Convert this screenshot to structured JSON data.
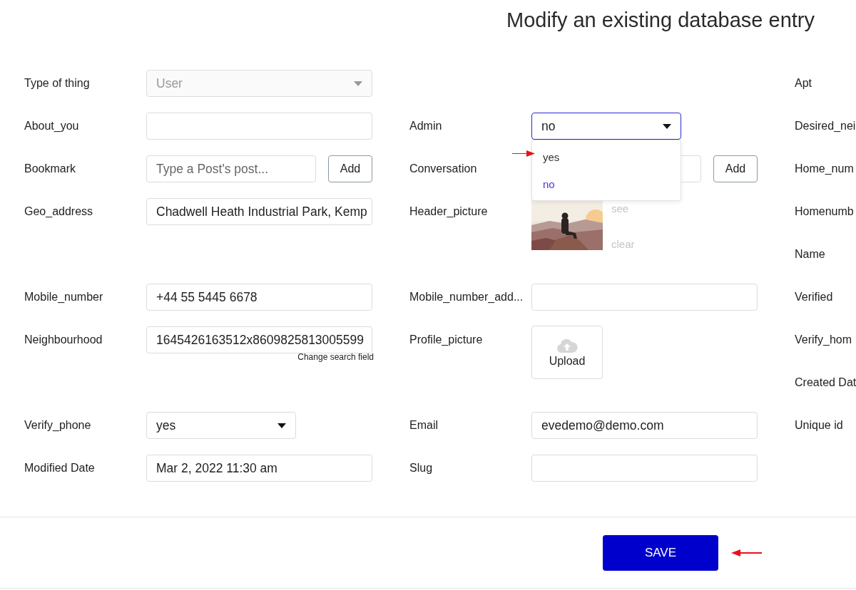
{
  "title": "Modify an existing database entry",
  "rows": [
    {
      "cells": [
        {
          "label": "Type of thing",
          "control": {
            "kind": "select",
            "value": "User",
            "disabled": true,
            "open": false
          }
        },
        null,
        {
          "label": "Apt"
        }
      ]
    },
    {
      "cells": [
        {
          "label": "About_you",
          "control": {
            "kind": "text"
          }
        },
        {
          "label": "Admin",
          "control": {
            "kind": "select",
            "value": "no",
            "disabled": false,
            "open": true,
            "narrow": true,
            "options": [
              {
                "label": "yes",
                "selected": false
              },
              {
                "label": "no",
                "selected": true
              }
            ]
          }
        },
        {
          "label": "Desired_nei"
        }
      ]
    },
    {
      "cells": [
        {
          "label": "Bookmark",
          "control": {
            "kind": "search_add",
            "placeholder": "Type a Post's post...",
            "button": "Add"
          }
        },
        {
          "label": "Conversation",
          "control": {
            "kind": "search_add",
            "button": "Add"
          }
        },
        {
          "label": "Home_num"
        }
      ]
    },
    {
      "cells": [
        {
          "label": "Geo_address",
          "control": {
            "kind": "text",
            "value": "Chadwell Heath Industrial Park, Kemp"
          }
        },
        {
          "label": "Header_picture",
          "control": {
            "links": [
              "see",
              "clear"
            ]
          }
        },
        {
          "label": "Homenumb"
        }
      ]
    },
    {
      "cells": [
        null,
        null,
        {
          "label": "Name"
        }
      ]
    },
    {
      "cells": [
        {
          "label": "Mobile_number",
          "control": {
            "kind": "text",
            "value": "+44 55 5445 6678"
          }
        },
        {
          "label": "Mobile_number_add...",
          "control": {
            "kind": "text"
          }
        },
        {
          "label": "Verified"
        }
      ]
    },
    {
      "cells": [
        {
          "label": "Neighbourhood",
          "control": {
            "kind": "text",
            "value": "1645426163512x8609825813005599",
            "hint": "Change search field"
          }
        },
        {
          "label": "Profile_picture",
          "control": {
            "kind": "upload",
            "label": "Upload"
          }
        },
        {
          "label": "Verify_hom"
        }
      ]
    },
    {
      "cells": [
        null,
        null,
        {
          "label": "Created Dat"
        }
      ]
    },
    {
      "cells": [
        {
          "label": "Verify_phone",
          "control": {
            "kind": "select",
            "value": "yes",
            "disabled": false,
            "open": false,
            "narrow": true
          }
        },
        {
          "label": "Email",
          "control": {
            "kind": "text",
            "value": "evedemo@demo.com"
          }
        },
        {
          "label": "Unique id"
        }
      ]
    },
    {
      "cells": [
        {
          "label": "Modified Date",
          "control": {
            "kind": "text",
            "value": "Mar 2, 2022 11:30 am"
          }
        },
        {
          "label": "Slug",
          "control": {
            "kind": "text"
          }
        },
        null
      ]
    }
  ],
  "save_button": "SAVE"
}
